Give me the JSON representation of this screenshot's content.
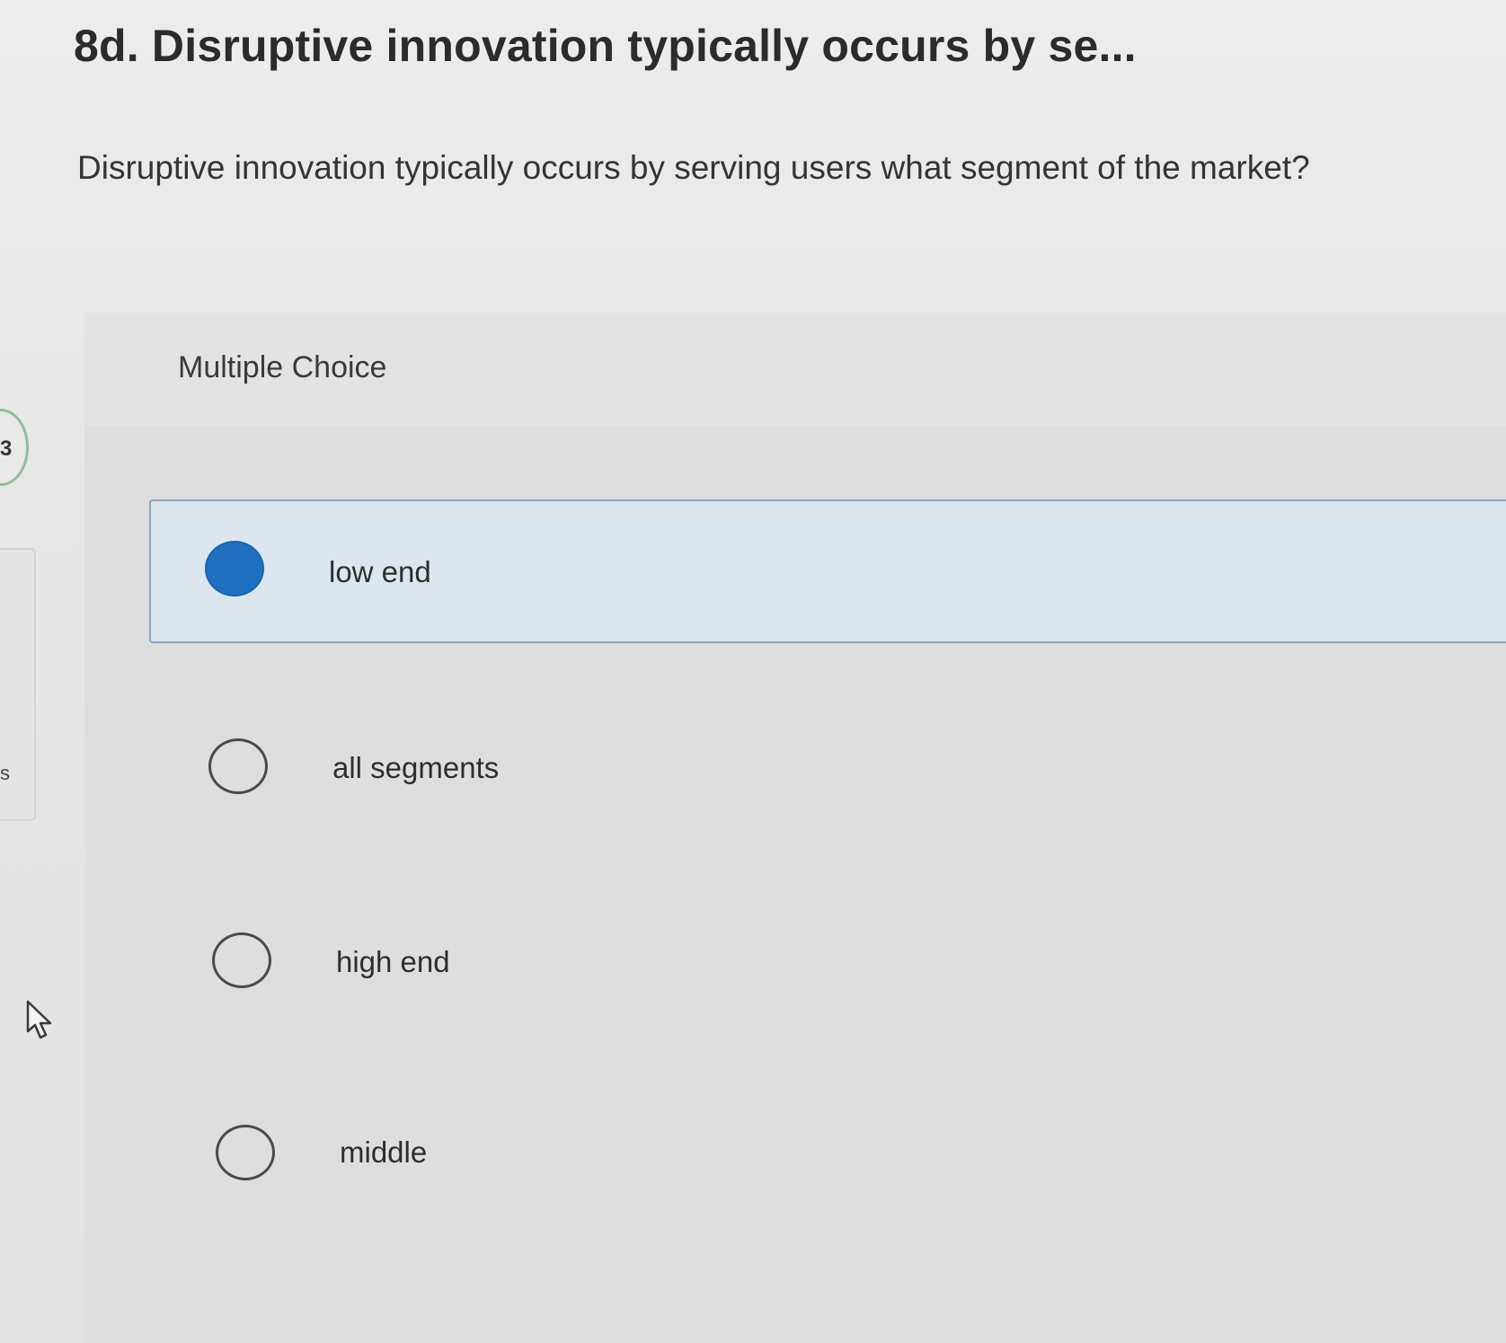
{
  "question": {
    "title": "8d. Disruptive innovation typically occurs by se...",
    "prompt": "Disruptive innovation typically occurs by serving users what segment of the market?"
  },
  "answer_panel": {
    "type_label": "Multiple Choice",
    "options": [
      {
        "label": "low end",
        "selected": true
      },
      {
        "label": "all segments",
        "selected": false
      },
      {
        "label": "high end",
        "selected": false
      },
      {
        "label": "middle",
        "selected": false
      }
    ]
  },
  "side_panel": {
    "top_letter": "3",
    "bottom_letter": "s"
  },
  "colors": {
    "selected_radio": "#1f6fc1",
    "selected_background": "#dbe6ee",
    "selected_border": "#8aa6c0"
  },
  "icons": {
    "cursor": "mouse-pointer-icon"
  }
}
